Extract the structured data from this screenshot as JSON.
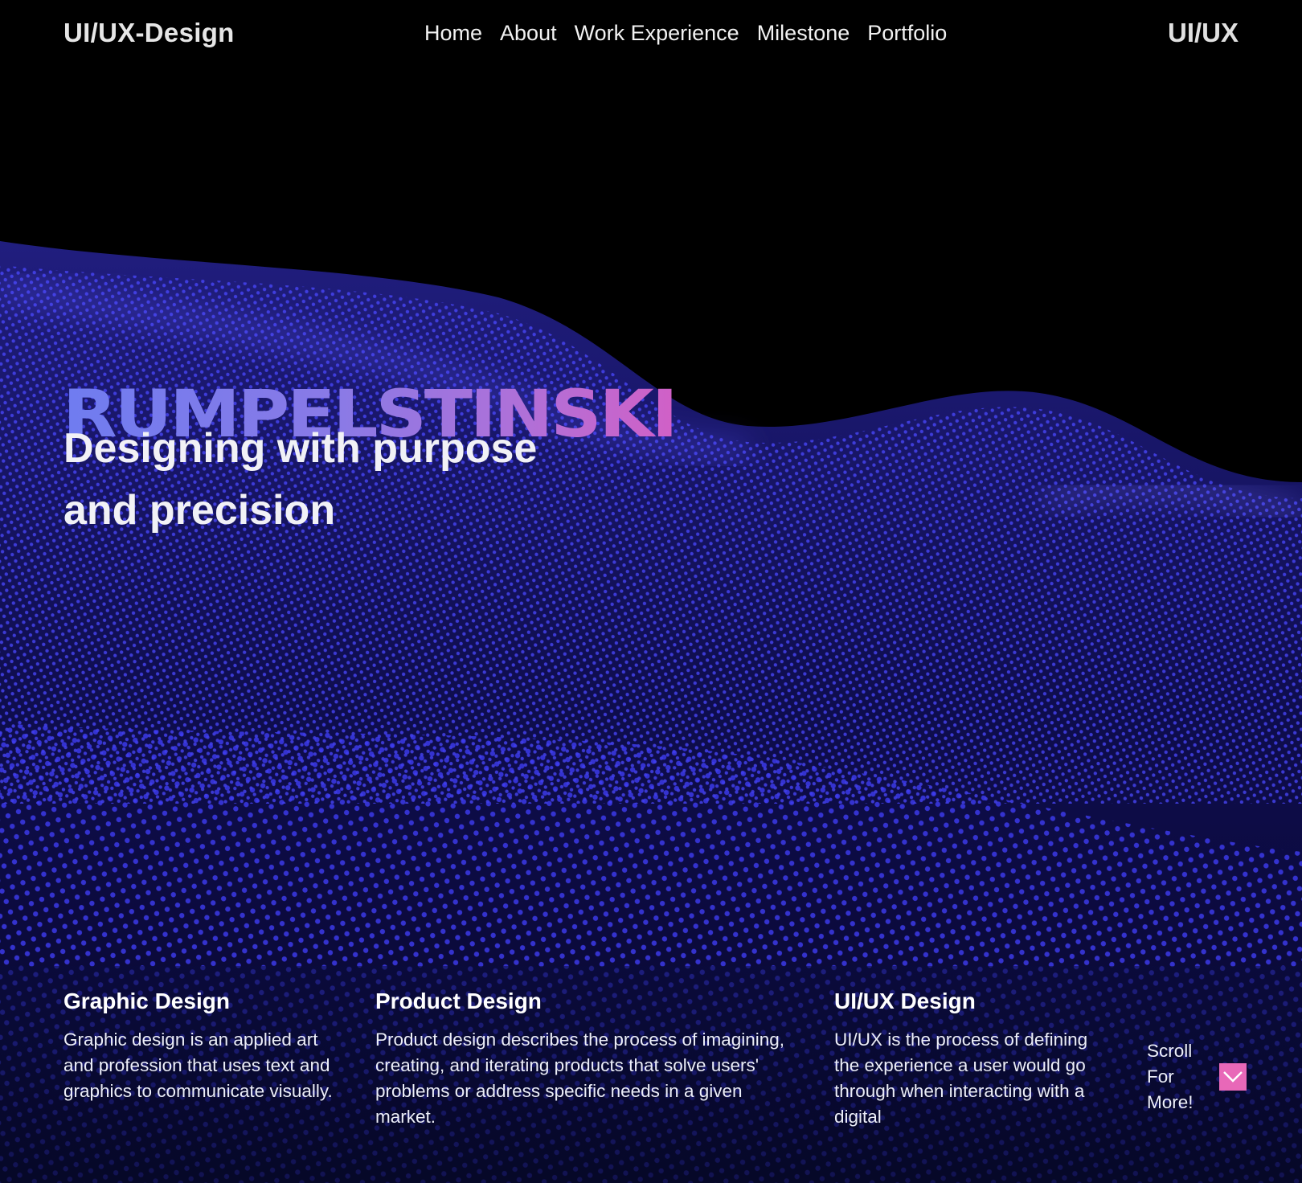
{
  "nav": {
    "brand": "UI/UX-Design",
    "links": [
      "Home",
      "About",
      "Work Experience",
      "Milestone",
      "Portfolio"
    ],
    "brand_right": "UI/UX"
  },
  "hero": {
    "name": "RUMPELSTINSKI",
    "tagline_line1": "Designing with purpose",
    "tagline_line2": "and precision"
  },
  "services": [
    {
      "title": "Graphic Design",
      "text": "Graphic design is an applied art and profession that uses text and graphics to communicate visually."
    },
    {
      "title": "Product Design",
      "text": "Product design describes the process of imagining, creating, and iterating products that solve users' problems or address specific needs in a given market."
    },
    {
      "title": "UI/UX Design",
      "text": "UI/UX is the process of defining the experience a user would go through when interacting with a digital"
    }
  ],
  "scroll": {
    "label": "Scroll For More!",
    "icon": "chevron-down-icon"
  },
  "colors": {
    "background": "#000000",
    "wave": "#3a35e0",
    "gradient_start": "#6f7cf0",
    "gradient_end": "#d160c6",
    "scroll_button": "#e868b8"
  }
}
